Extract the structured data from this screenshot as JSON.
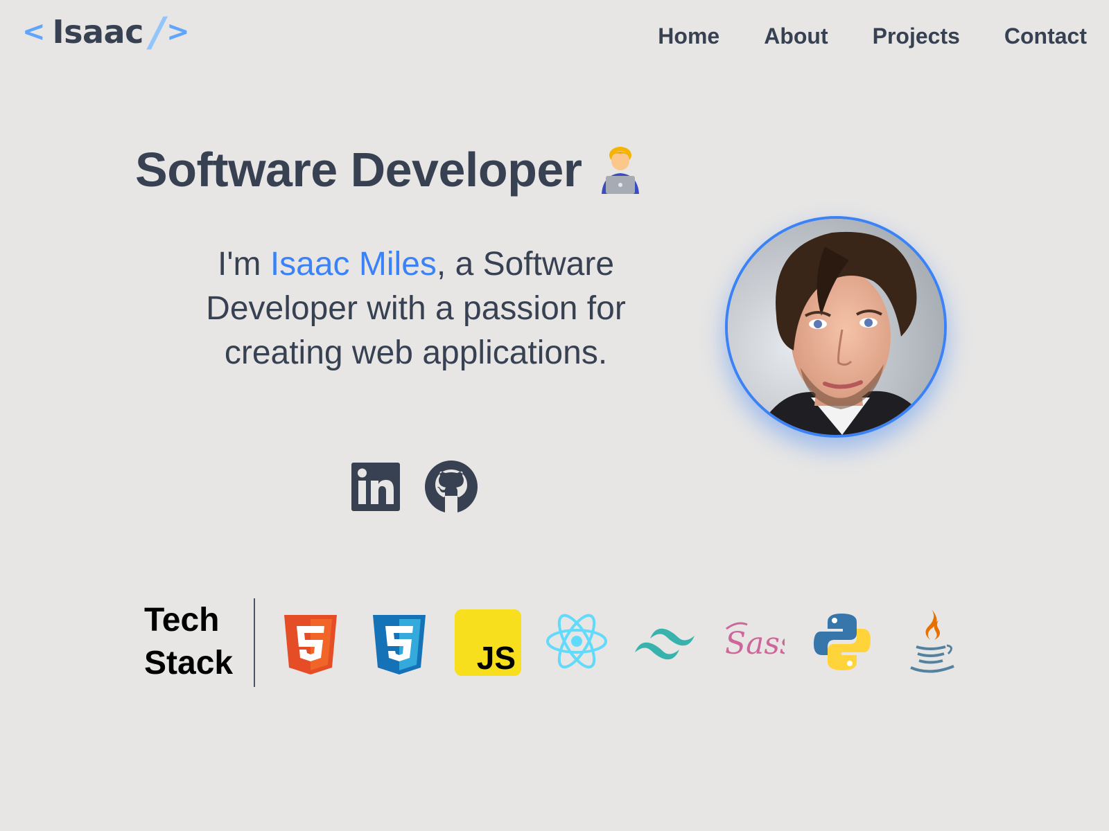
{
  "logo": {
    "bracket_left": "<",
    "name": "Isaac",
    "slash": "/",
    "bracket_right": ">"
  },
  "nav": {
    "items": [
      {
        "label": "Home"
      },
      {
        "label": "About"
      },
      {
        "label": "Projects"
      },
      {
        "label": "Contact"
      }
    ]
  },
  "hero": {
    "title": "Software Developer",
    "emoji_icon": "man-technologist-icon",
    "intro_prefix": "I'm ",
    "name": "Isaac Miles",
    "intro_suffix": ", a Software Developer with a passion for creating web applications.",
    "accent_color": "#3b82f6"
  },
  "socials": [
    {
      "icon": "linkedin-icon"
    },
    {
      "icon": "github-icon"
    }
  ],
  "avatar": {
    "border_color": "#3b82f6"
  },
  "tech_stack": {
    "label_line1": "Tech",
    "label_line2": "Stack",
    "icons": [
      {
        "icon": "html5-icon",
        "color": "#e44d26"
      },
      {
        "icon": "css3-icon",
        "color": "#1572b6"
      },
      {
        "icon": "javascript-icon",
        "color": "#f7df1e"
      },
      {
        "icon": "react-icon",
        "color": "#61dafb"
      },
      {
        "icon": "tailwind-icon",
        "color": "#38b2ac"
      },
      {
        "icon": "sass-icon",
        "color": "#cd6799"
      },
      {
        "icon": "python-icon",
        "color": "#3776ab"
      },
      {
        "icon": "java-icon",
        "color": "#e76f00"
      }
    ]
  }
}
